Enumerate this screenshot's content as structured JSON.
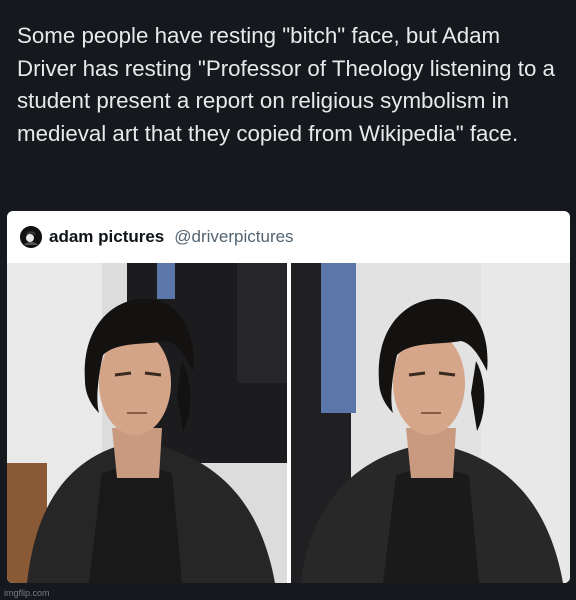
{
  "caption": {
    "text": "Some people have resting \"bitch\" face, but Adam Driver has resting \"Professor of Theology listening to a student present a report on religious symbolism in medieval art that they copied from Wikipedia\" face."
  },
  "tweet": {
    "display_name": "adam pictures",
    "handle": "@driverpictures",
    "avatar_icon": "profile-avatar-icon",
    "photos": [
      {
        "icon": "photo-man-in-leather-jacket-left"
      },
      {
        "icon": "photo-man-in-leather-jacket-right"
      }
    ]
  },
  "watermark": {
    "text": "imgflip.com"
  },
  "colors": {
    "background": "#15181c",
    "caption_text": "#e7e9ea",
    "card": "#ffffff",
    "handle": "#536471"
  }
}
